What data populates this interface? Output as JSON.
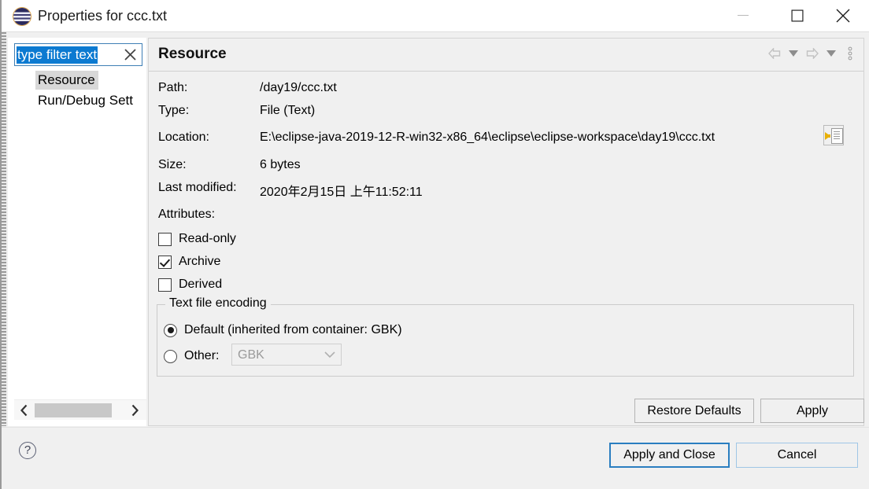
{
  "window": {
    "title": "Properties for ccc.txt",
    "icon": "eclipse-icon",
    "controls": {
      "minimize": "minimize-icon",
      "maximize": "maximize-icon",
      "close": "close-icon"
    }
  },
  "tree": {
    "filter": {
      "value": "type filter text",
      "placeholder": "type filter text",
      "clear_icon": "clear-icon"
    },
    "items": [
      {
        "label": "Resource",
        "selected": true
      },
      {
        "label": "Run/Debug Sett",
        "selected": false
      }
    ],
    "scrollbar": {
      "left_icon": "chevron-left-icon",
      "right_icon": "chevron-right-icon"
    }
  },
  "page": {
    "title": "Resource",
    "tools": [
      {
        "name": "back-arrow-icon"
      },
      {
        "name": "back-dropdown-icon"
      },
      {
        "name": "forward-arrow-icon"
      },
      {
        "name": "forward-dropdown-icon"
      },
      {
        "name": "view-menu-icon"
      }
    ],
    "properties": [
      {
        "label": "Path:",
        "value": "/day19/ccc.txt"
      },
      {
        "label": "Type:",
        "value": "File  (Text)"
      },
      {
        "label": "Location:",
        "value": "E:\\eclipse-java-2019-12-R-win32-x86_64\\eclipse\\eclipse-workspace\\day19\\ccc.txt"
      },
      {
        "label": "Size:",
        "value": "6  bytes"
      },
      {
        "label": "Last modified:",
        "value": "2020年2月15日 上午11:52:11"
      }
    ],
    "location_button": "resolve-path-icon",
    "attributes": {
      "label": "Attributes:",
      "items": [
        {
          "label": "Read-only",
          "checked": false
        },
        {
          "label": "Archive",
          "checked": true
        },
        {
          "label": "Derived",
          "checked": false
        }
      ]
    },
    "encoding": {
      "legend": "Text file encoding",
      "default_option": "Default (inherited from container: GBK)",
      "default_selected": true,
      "other_option": "Other:",
      "other_selected": false,
      "other_value": "GBK",
      "caret_icon": "chevron-down-icon"
    },
    "buttons": {
      "restore_defaults": "Restore Defaults",
      "apply": "Apply"
    }
  },
  "footer": {
    "help_icon": "help-icon",
    "help_label": "?",
    "apply_and_close": "Apply and Close",
    "cancel": "Cancel"
  },
  "colors": {
    "accent": "#0c7ad1",
    "default_button_border": "#2a7ec0",
    "dialog_bg": "#f0f0f0",
    "selection_gray": "#d8d8d8"
  }
}
